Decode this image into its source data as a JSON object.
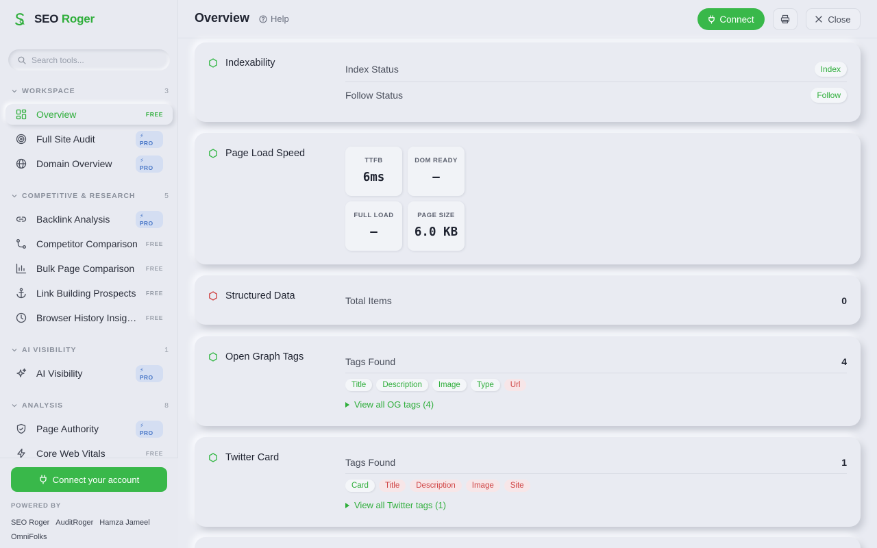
{
  "brand": {
    "name_part1": "SEO",
    "name_part2": "Roger",
    "accent": "#2fae3b"
  },
  "search": {
    "placeholder": "Search tools..."
  },
  "sidebar": {
    "groups": [
      {
        "label": "WORKSPACE",
        "count": "3"
      },
      {
        "label": "COMPETITIVE & RESEARCH",
        "count": "5"
      },
      {
        "label": "AI VISIBILITY",
        "count": "1"
      },
      {
        "label": "ANALYSIS",
        "count": "8"
      }
    ],
    "items": [
      {
        "label": "Overview",
        "tag": "FREE",
        "icon": "grid-icon"
      },
      {
        "label": "Full Site Audit",
        "tag": "PRO",
        "icon": "target-icon"
      },
      {
        "label": "Domain Overview",
        "tag": "PRO",
        "icon": "globe-icon"
      },
      {
        "label": "Backlink Analysis",
        "tag": "PRO",
        "icon": "link-icon"
      },
      {
        "label": "Competitor Comparison",
        "tag": "FREE",
        "icon": "compare-icon"
      },
      {
        "label": "Bulk Page Comparison",
        "tag": "FREE",
        "icon": "bar-chart-icon"
      },
      {
        "label": "Link Building Prospects",
        "tag": "FREE",
        "icon": "anchor-icon"
      },
      {
        "label": "Browser History Insights",
        "tag": "FREE",
        "icon": "clock-icon"
      },
      {
        "label": "AI Visibility",
        "tag": "PRO",
        "icon": "sparkles-icon"
      },
      {
        "label": "Page Authority",
        "tag": "PRO",
        "icon": "shield-icon"
      },
      {
        "label": "Core Web Vitals",
        "tag": "FREE",
        "icon": "bolt-icon"
      }
    ],
    "pro_badge": "⚡ PRO",
    "footer": {
      "connect_label": "Connect your account",
      "powered_label": "POWERED BY",
      "links": [
        "SEO Roger",
        "AuditRoger",
        "Hamza Jameel",
        "OmniFolks"
      ]
    }
  },
  "header": {
    "title": "Overview",
    "help_label": "Help",
    "connect_label": "Connect",
    "close_label": "Close"
  },
  "cards": {
    "indexability": {
      "title": "Indexability",
      "status": "ok",
      "rows": [
        {
          "label": "Index Status",
          "value": "Index"
        },
        {
          "label": "Follow Status",
          "value": "Follow"
        }
      ]
    },
    "page_load": {
      "title": "Page Load Speed",
      "status": "ok",
      "metrics": [
        {
          "label": "TTFB",
          "value": "6ms"
        },
        {
          "label": "DOM READY",
          "value": "—"
        },
        {
          "label": "FULL LOAD",
          "value": "—"
        },
        {
          "label": "PAGE SIZE",
          "value": "6.0 KB"
        }
      ]
    },
    "structured": {
      "title": "Structured Data",
      "status": "error",
      "row": {
        "label": "Total Items",
        "value": "0"
      }
    },
    "og": {
      "title": "Open Graph Tags",
      "status": "ok",
      "row": {
        "label": "Tags Found",
        "value": "4"
      },
      "chips": [
        {
          "label": "Title",
          "state": "ok"
        },
        {
          "label": "Description",
          "state": "ok"
        },
        {
          "label": "Image",
          "state": "ok"
        },
        {
          "label": "Type",
          "state": "ok"
        },
        {
          "label": "Url",
          "state": "missing"
        }
      ],
      "link": "View all OG tags (4)"
    },
    "twitter": {
      "title": "Twitter Card",
      "status": "ok",
      "row": {
        "label": "Tags Found",
        "value": "1"
      },
      "chips": [
        {
          "label": "Card",
          "state": "ok"
        },
        {
          "label": "Title",
          "state": "missing"
        },
        {
          "label": "Description",
          "state": "missing"
        },
        {
          "label": "Image",
          "state": "missing"
        },
        {
          "label": "Site",
          "state": "missing"
        }
      ],
      "link": "View all Twitter tags (1)"
    }
  },
  "colors": {
    "green": "#39b84a",
    "red": "#d04545",
    "pro_blue": "#4a78c8"
  }
}
